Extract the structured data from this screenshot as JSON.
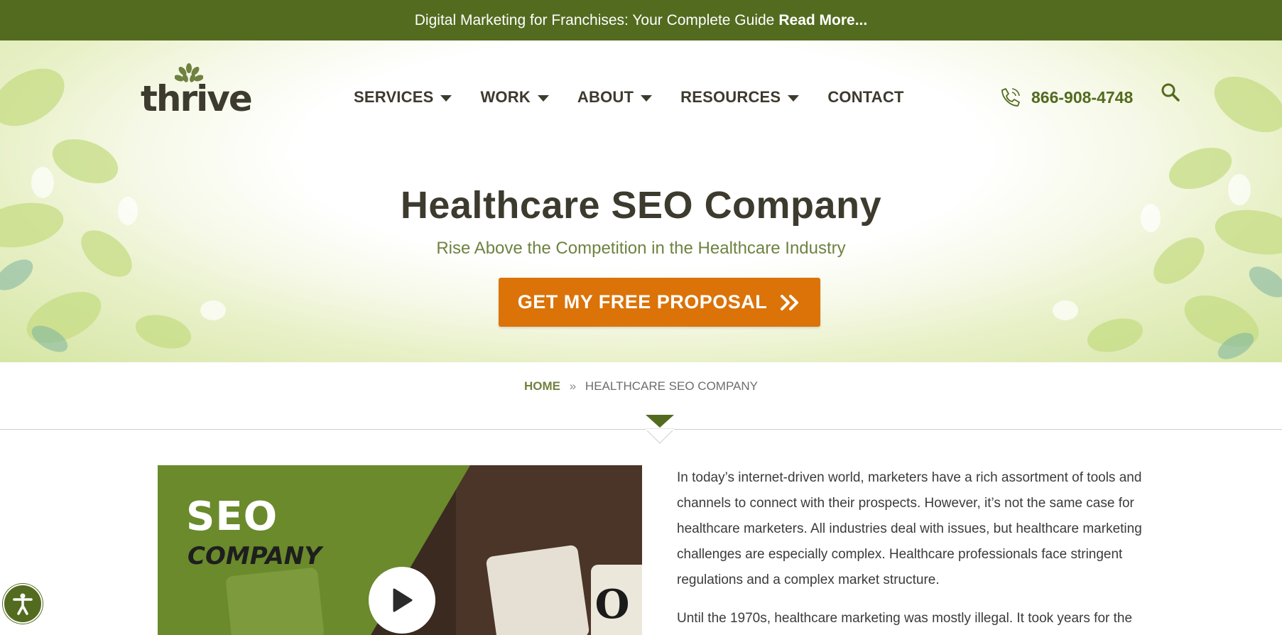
{
  "promo": {
    "text": "Digital Marketing for Franchises: Your Complete Guide",
    "link": "Read More..."
  },
  "header": {
    "logo_text": "thrive",
    "nav": [
      {
        "label": "SERVICES",
        "has_dropdown": true
      },
      {
        "label": "WORK",
        "has_dropdown": true
      },
      {
        "label": "ABOUT",
        "has_dropdown": true
      },
      {
        "label": "RESOURCES",
        "has_dropdown": true
      },
      {
        "label": "CONTACT",
        "has_dropdown": false
      }
    ],
    "phone": "866-908-4748",
    "phone_icon": "phone-icon",
    "search_icon": "search-icon"
  },
  "hero": {
    "title": "Healthcare SEO Company",
    "subtitle": "Rise Above the Competition in the Healthcare Industry",
    "cta": "GET MY FREE PROPOSAL"
  },
  "breadcrumb": {
    "home": "HOME",
    "separator": "»",
    "current": "HEALTHCARE SEO COMPANY"
  },
  "video": {
    "title": "SEO",
    "subtitle": "COMPANY",
    "play_icon": "play-icon"
  },
  "content": {
    "paragraphs": [
      "In today’s internet-driven world, marketers have a rich assortment of tools and channels to connect with their prospects. However, it’s not the same case for healthcare marketers. All industries deal with issues, but healthcare marketing challenges are especially complex. Healthcare professionals face stringent regulations and a complex market structure.",
      "Until the 1970s, healthcare marketing was mostly illegal. It took years for the"
    ]
  },
  "colors": {
    "brand_green": "#536b1f",
    "cta_orange": "#db7309",
    "text_dark": "#3d3a2e",
    "accent_green": "#6f8240"
  },
  "accessibility_icon": "accessibility-icon"
}
